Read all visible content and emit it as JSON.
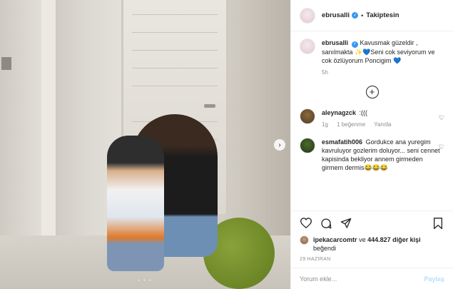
{
  "header": {
    "username": "ebrusalli",
    "separator": "•",
    "follow_label": "Takiptesin"
  },
  "caption": {
    "username": "ebrusalli",
    "text": "Kavusmak güzeldir , sanılmakta ✨💙Seni cok seviyorum ve cok özlüyorum Poncigim 💙",
    "time": "5h"
  },
  "comments": [
    {
      "username": "aleynagzck",
      "text": ":(((",
      "time": "1g",
      "likes": "1 beğenme",
      "reply_label": "Yanıtla"
    },
    {
      "username": "esmafatih006",
      "text": "Gordukce ana yuregim kavruluyor gozlerim doluyor... seni cennet kapisinda bekliyor annem girmeden girmem dermis😂😂😂"
    }
  ],
  "likes": {
    "user": "ipekacarcomtr",
    "connector": "ve",
    "count_text": "444.827 diğer kişi",
    "suffix": "beğendi"
  },
  "date": "29 HAZİRAN",
  "add_comment": {
    "placeholder": "Yorum ekle...",
    "post_label": "Paylaş"
  },
  "icons": {
    "verified": "verified-badge-icon",
    "heart": "heart-icon",
    "comment": "comment-icon",
    "share": "share-icon",
    "save": "bookmark-icon",
    "more": "plus-circle-icon"
  },
  "colors": {
    "verified": "#3897f0",
    "post_button": "#b2dffc",
    "muted": "#8e8e8e"
  }
}
